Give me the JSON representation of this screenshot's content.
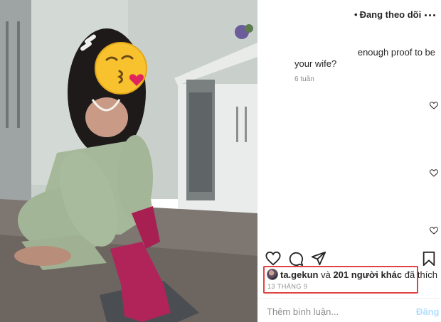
{
  "header": {
    "follow_dot": "•",
    "follow_label": "Đang theo dõi",
    "more_icon": "more-horizontal-icon"
  },
  "comment": {
    "line1": "enough proof to be",
    "line2": "your wife?",
    "time_ago": "6 tuần"
  },
  "likes": {
    "user": "ta.gekun",
    "conjunction": "và",
    "others": "201 người khác",
    "suffix": "đã thích",
    "date": "13 THÁNG 9"
  },
  "composer": {
    "placeholder": "Thêm bình luận...",
    "post_label": "Đăng"
  },
  "colors": {
    "highlight_border": "#e04343",
    "post_button": "#b2dffc",
    "muted_text": "#8e8e8e"
  }
}
